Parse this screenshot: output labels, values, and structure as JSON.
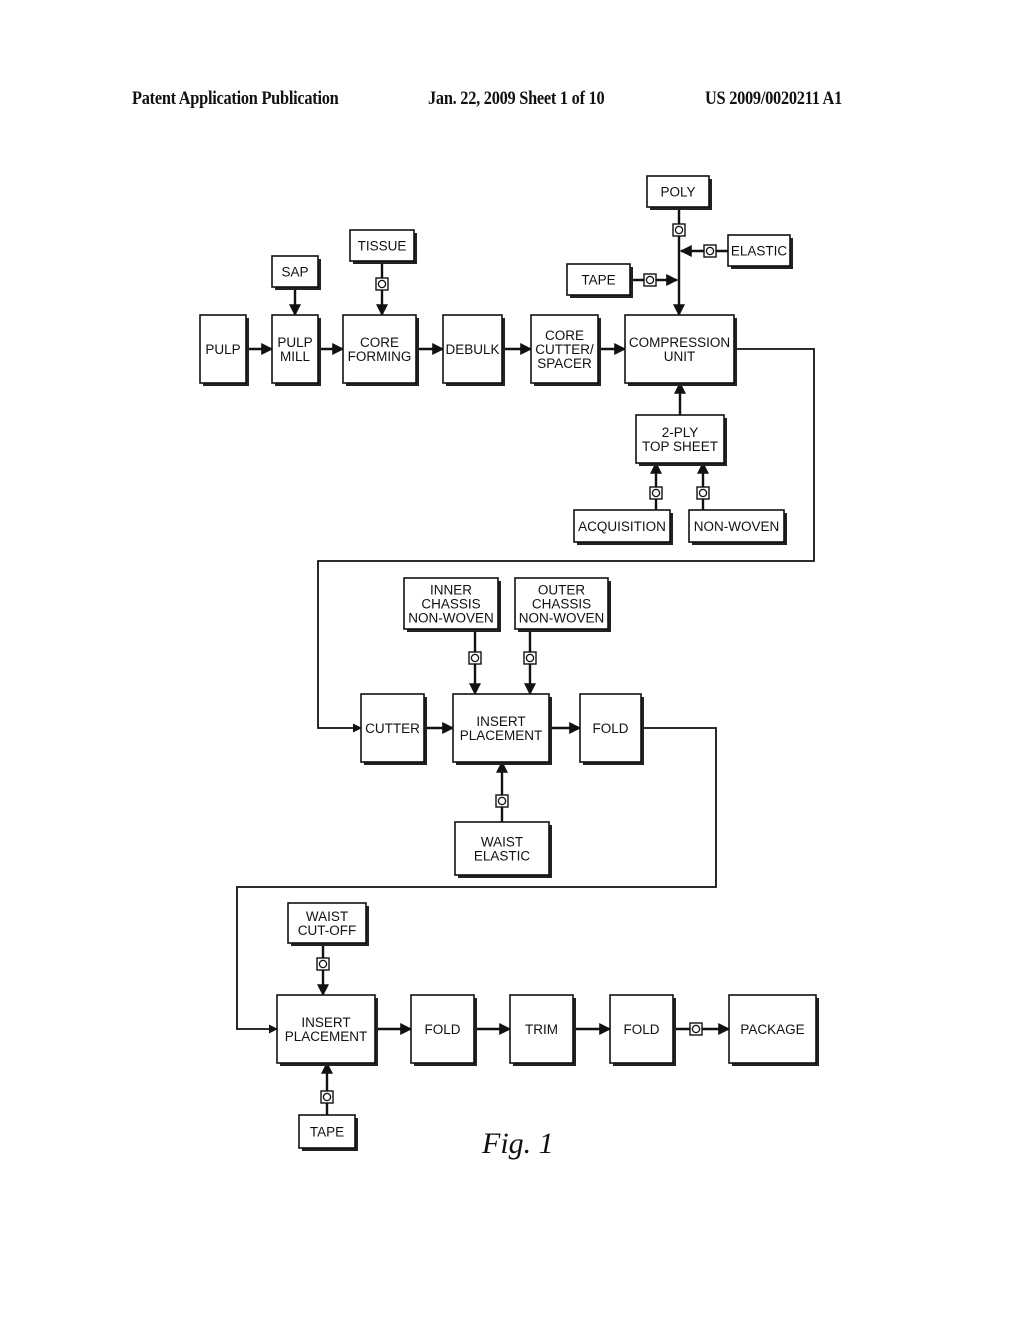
{
  "header": {
    "publication": "Patent Application Publication",
    "date_sheet": "Jan. 22, 2009  Sheet 1 of 10",
    "number": "US 2009/0020211 A1"
  },
  "figure_label": "Fig. 1",
  "boxes": {
    "pulp": [
      "PULP"
    ],
    "sap": [
      "SAP"
    ],
    "pulp_mill": [
      "PULP",
      "MILL"
    ],
    "tissue": [
      "TISSUE"
    ],
    "core_forming": [
      "CORE",
      "FORMING"
    ],
    "debulk": [
      "DEBULK"
    ],
    "core_cutter": [
      "CORE",
      "CUTTER/",
      "SPACER"
    ],
    "poly": [
      "POLY"
    ],
    "elastic": [
      "ELASTIC"
    ],
    "tape_top": [
      "TAPE"
    ],
    "compression": [
      "COMPRESSION",
      "UNIT"
    ],
    "top_sheet": [
      "2-PLY",
      "TOP SHEET"
    ],
    "acquisition": [
      "ACQUISITION"
    ],
    "non_woven": [
      "NON-WOVEN"
    ],
    "inner_chassis": [
      "INNER",
      "CHASSIS",
      "NON-WOVEN"
    ],
    "outer_chassis": [
      "OUTER",
      "CHASSIS",
      "NON-WOVEN"
    ],
    "cutter": [
      "CUTTER"
    ],
    "insert_placement_1": [
      "INSERT",
      "PLACEMENT"
    ],
    "fold_1": [
      "FOLD"
    ],
    "waist_elastic": [
      "WAIST",
      "ELASTIC"
    ],
    "waist_cutoff": [
      "WAIST",
      "CUT-OFF"
    ],
    "insert_placement_2": [
      "INSERT",
      "PLACEMENT"
    ],
    "fold_2": [
      "FOLD"
    ],
    "trim": [
      "TRIM"
    ],
    "fold_3": [
      "FOLD"
    ],
    "package": [
      "PACKAGE"
    ],
    "tape_bottom": [
      "TAPE"
    ]
  },
  "valve_symbol": "O"
}
